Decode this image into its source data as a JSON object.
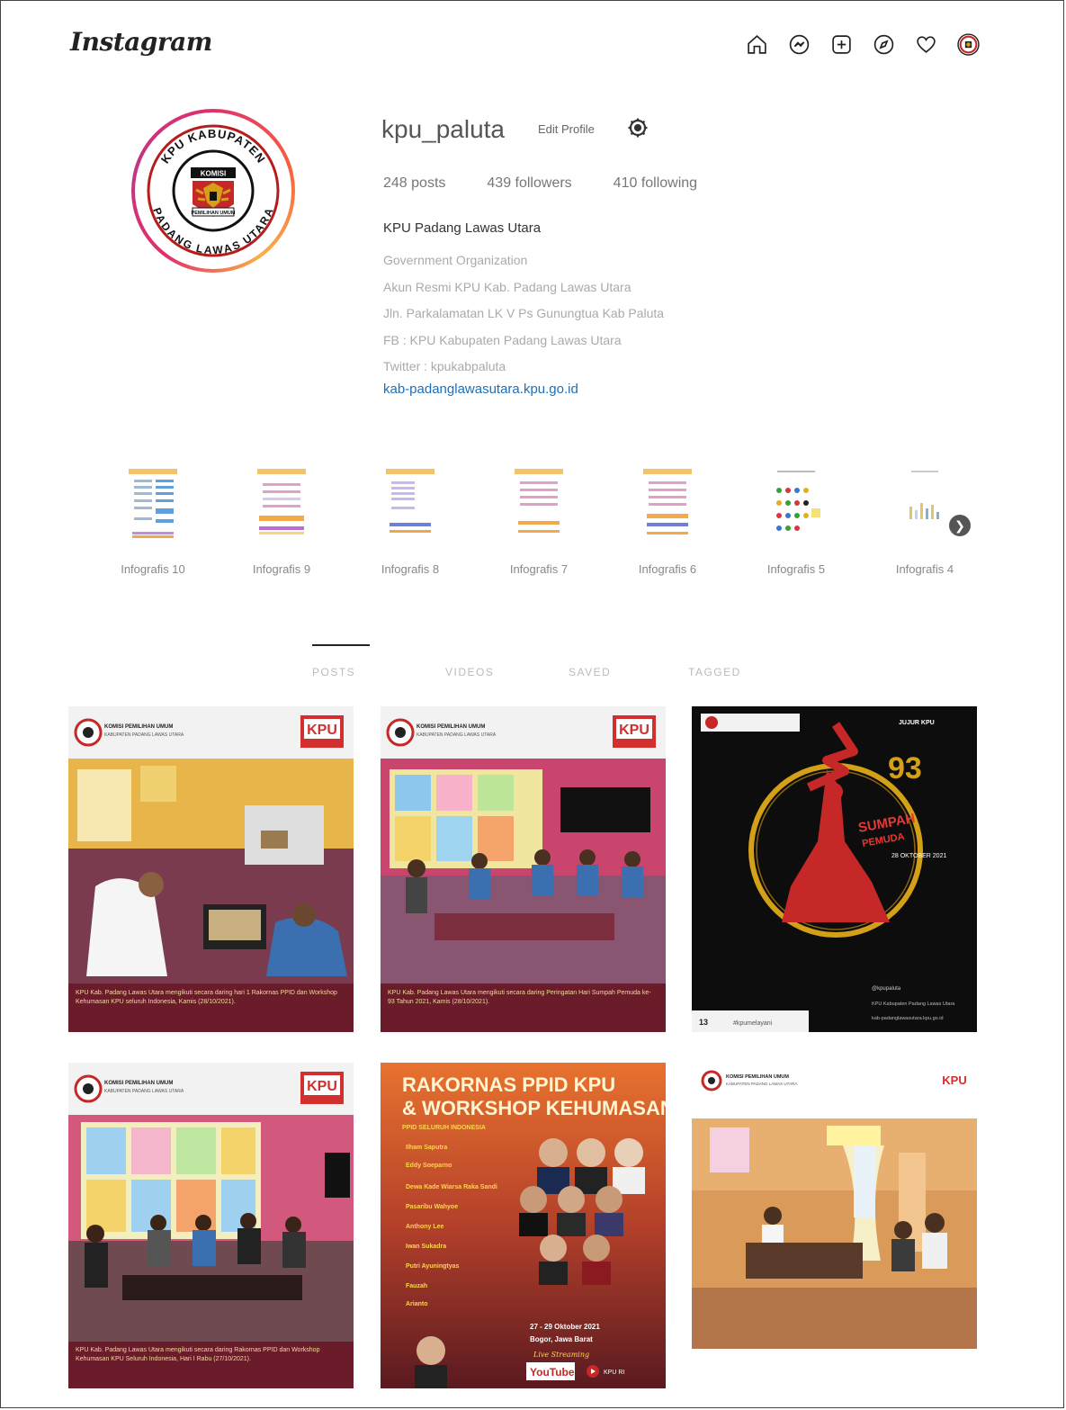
{
  "app": {
    "logo": "Instagram"
  },
  "nav_icons": [
    "home-icon",
    "messenger-icon",
    "new-post-icon",
    "explore-icon",
    "activity-heart-icon",
    "profile-avatar-icon"
  ],
  "profile": {
    "username": "kpu_paluta",
    "edit_profile_label": "Edit Profile",
    "stats": {
      "posts": "248 posts",
      "followers": "439 followers",
      "following": "410 following"
    },
    "full_name": "KPU Padang Lawas Utara",
    "bio_lines": [
      "Government Organization",
      "Akun Resmi KPU Kab. Padang Lawas Utara",
      "Jln. Parkalamatan LK V Ps Gunungtua Kab Paluta",
      "FB : KPU Kabupaten Padang Lawas Utara",
      "Twitter : kpukabpaluta"
    ],
    "website": "kab-padanglawasutara.kpu.go.id",
    "avatar_text": {
      "top": "KPU KABUPATEN",
      "bottom": "PADANG LAWAS UTARA",
      "inner_top": "KOMISI",
      "inner_bottom": "PEMILIHAN UMUM"
    }
  },
  "highlights": [
    {
      "label": "Infografis 10"
    },
    {
      "label": "Infografis 9"
    },
    {
      "label": "Infografis 8"
    },
    {
      "label": "Infografis 7"
    },
    {
      "label": "Infografis 6"
    },
    {
      "label": "Infografis 5"
    },
    {
      "label": "Infografis 4"
    }
  ],
  "tabs": [
    {
      "label": "POSTS",
      "active": true
    },
    {
      "label": "VIDEOS",
      "active": false
    },
    {
      "label": "SAVED",
      "active": false
    },
    {
      "label": "TAGGED",
      "active": false
    }
  ],
  "posts": [
    {
      "header_org": "KOMISI PEMILIHAN UMUM",
      "header_sub": "KABUPATEN PADANG LAWAS UTARA",
      "badge": "KPU",
      "caption": "KPU Kab. Padang Lawas Utara mengikuti secara daring hari 1 Rakornas PPID dan Workshop Kehumasan KPU seluruh Indonesia, Kamis (28/10/2021)."
    },
    {
      "header_org": "KOMISI PEMILIHAN UMUM",
      "header_sub": "KABUPATEN PADANG LAWAS UTARA",
      "badge": "KPU",
      "caption": "KPU Kab. Padang Lawas Utara mengikuti secara daring Peringatan Hari Sumpah Pemuda ke-93 Tahun 2021, Kamis (28/10/2021)."
    },
    {
      "header_right": "JUJUR KPU",
      "number": "93",
      "title_line1": "SUMPAH",
      "title_line2": "PEMUDA",
      "date": "28 OKTOBER 2021",
      "footer_handle": "@kpupaluta",
      "footer_fb": "KPU Kabupaten Padang Lawas Utara",
      "footer_web": "kab-padanglawasutara.kpu.go.id",
      "likes": "13",
      "tag": "#kpumelayani"
    },
    {
      "header_org": "KOMISI PEMILIHAN UMUM",
      "header_sub": "KABUPATEN PADANG LAWAS UTARA",
      "badge": "KPU",
      "caption": "KPU Kab. Padang Lawas Utara mengikuti secara daring Rakornas PPID dan Workshop Kehumasan KPU Seluruh Indonesia, Hari I Rabu (27/10/2021)."
    },
    {
      "title_line1": "RAKORNAS PPID KPU",
      "title_line2": "& WORKSHOP KEHUMASAN",
      "subtitle": "PPID SELURUH INDONESIA",
      "speakers": [
        "Ilham Saputra",
        "Eddy Soeparno",
        "Dewa Kade Wiarsa Raka Sandi",
        "Pasaribu Wahyoe",
        "Anthony Lee",
        "Iwan Sukadra",
        "Putri Ayuningtyas",
        "Fauzah",
        "Arianto"
      ],
      "event_date": "27 - 29 Oktober 2021",
      "event_place": "Bogor, Jawa Barat",
      "live_label": "Live Streaming",
      "youtube": "YouTube",
      "channel": "KPU RI"
    },
    {
      "header_org": "KOMISI PEMILIHAN UMUM",
      "header_sub": "KABUPATEN PADANG LAWAS UTARA",
      "badge": "KPU"
    }
  ],
  "colors": {
    "link": "#1d6fb8",
    "kpu_red": "#d32f2f",
    "caption_bar": "#6b1c2a",
    "gold": "#d4a017",
    "gradient": [
      "#e1306c",
      "#fcaf45"
    ]
  }
}
